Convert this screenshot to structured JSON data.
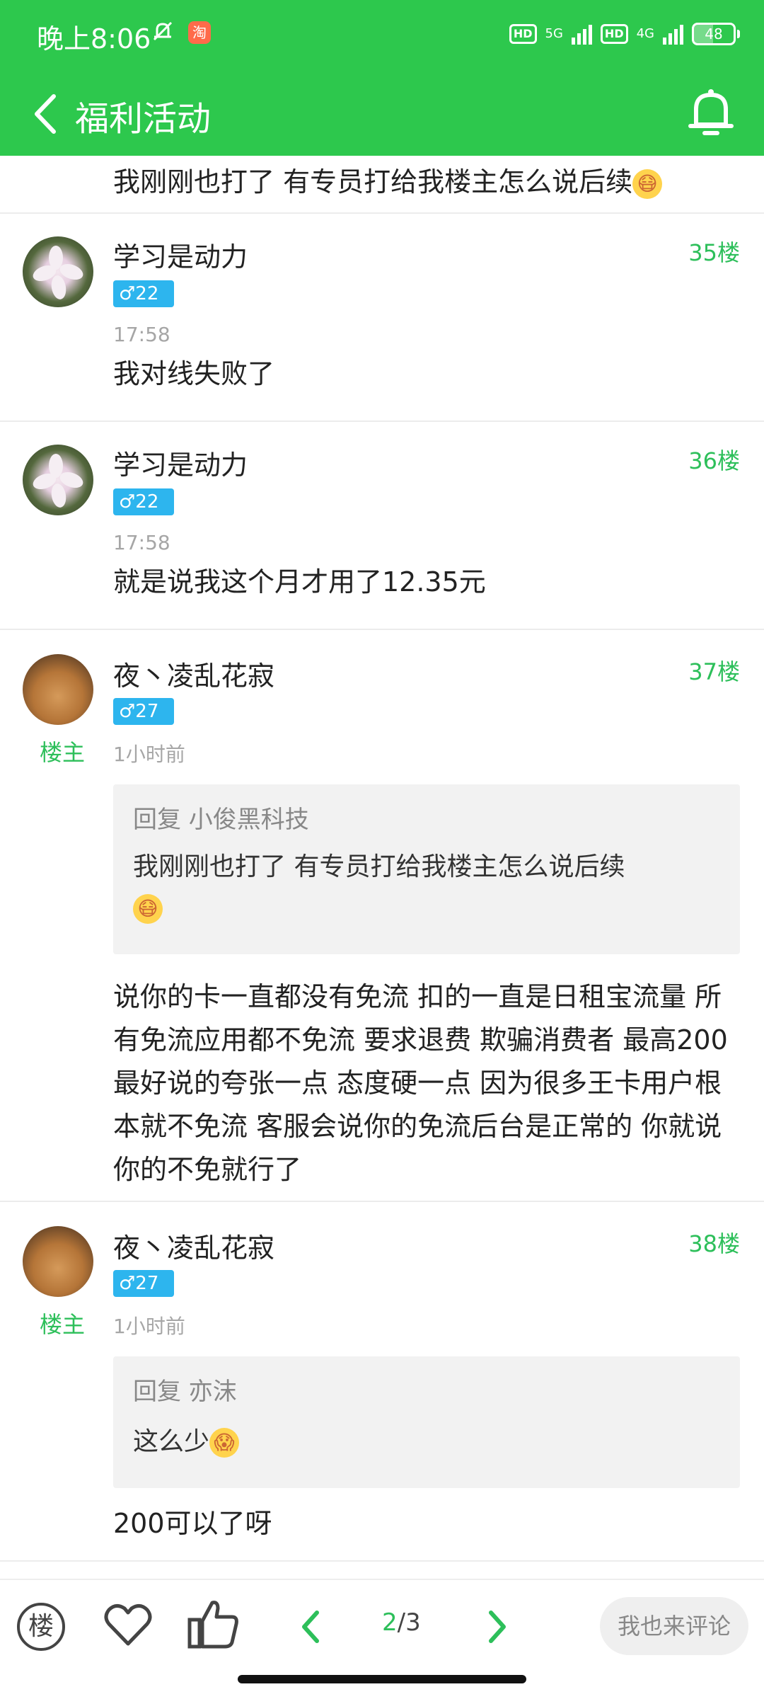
{
  "status_bar": {
    "time": "晚上8:06",
    "taobao_badge": "淘",
    "net1": "5G",
    "net2": "4G",
    "hd": "HD",
    "battery": "48"
  },
  "header": {
    "title": "福利活动"
  },
  "partial_post": {
    "text": "我刚刚也打了  有专员打给我楼主怎么说后续"
  },
  "posts": [
    {
      "username": "学习是动力",
      "badge": "♂22",
      "floor": "35楼",
      "time": "17:58",
      "body": "我对线失败了"
    },
    {
      "username": "学习是动力",
      "badge": "♂22",
      "floor": "36楼",
      "time": "17:58",
      "body": "就是说我这个月才用了12.35元"
    },
    {
      "username": "夜丶凌乱花寂",
      "badge": "♂27",
      "floor": "37楼",
      "time": "1小时前",
      "op": "楼主",
      "quote_head": "回复 小俊黑科技",
      "quote_body": "我刚刚也打了  有专员打给我楼主怎么说后续",
      "body": "说你的卡一直都没有免流 扣的一直是日租宝流量 所有免流应用都不免流 要求退费 欺骗消费者 最高200 最好说的夸张一点 态度硬一点 因为很多王卡用户根本就不免流 客服会说你的免流后台是正常的 你就说你的不免就行了"
    },
    {
      "username": "夜丶凌乱花寂",
      "badge": "♂27",
      "floor": "38楼",
      "time": "1小时前",
      "op": "楼主",
      "quote_head": "回复 亦沫",
      "quote_body": "这么少",
      "body": "200可以了呀"
    }
  ],
  "bottom_bar": {
    "floor_btn": "楼",
    "page_current": "2",
    "page_sep_total": "/3",
    "comment_placeholder": "我也来评论"
  },
  "colors": {
    "accent": "#2dc84d",
    "floor_green": "#2dbf5a",
    "badge_blue": "#2db5ee"
  }
}
